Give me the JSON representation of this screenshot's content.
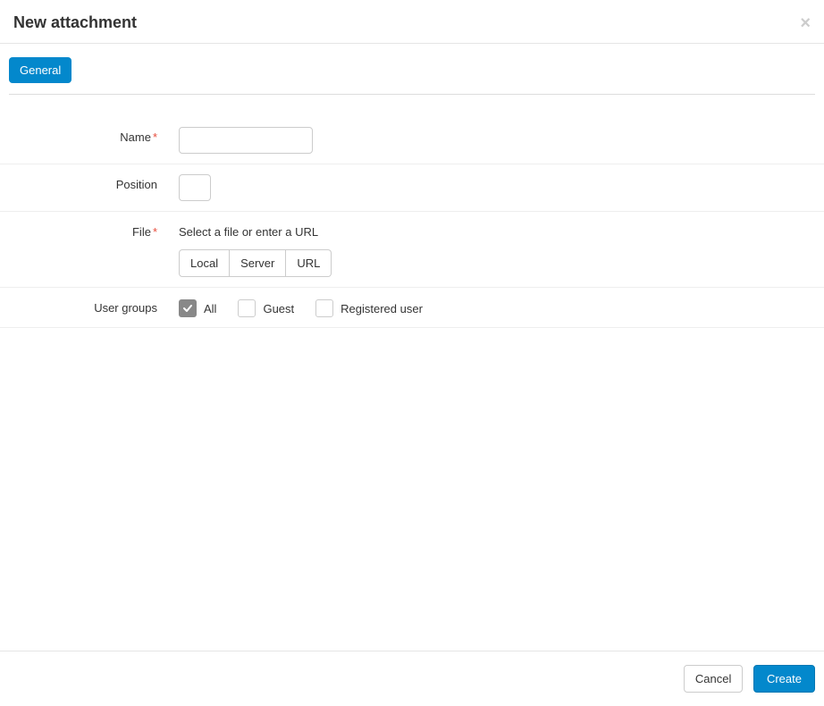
{
  "header": {
    "title": "New attachment",
    "close_label": "×"
  },
  "tabs": {
    "general": "General"
  },
  "form": {
    "name": {
      "label": "Name",
      "required": true,
      "value": ""
    },
    "position": {
      "label": "Position",
      "required": false,
      "value": ""
    },
    "file": {
      "label": "File",
      "required": true,
      "hint": "Select a file or enter a URL",
      "options": {
        "local": "Local",
        "server": "Server",
        "url": "URL"
      }
    },
    "user_groups": {
      "label": "User groups",
      "options": [
        {
          "label": "All",
          "checked": true
        },
        {
          "label": "Guest",
          "checked": false
        },
        {
          "label": "Registered user",
          "checked": false
        }
      ]
    }
  },
  "footer": {
    "cancel": "Cancel",
    "create": "Create"
  },
  "required_marker": "*"
}
